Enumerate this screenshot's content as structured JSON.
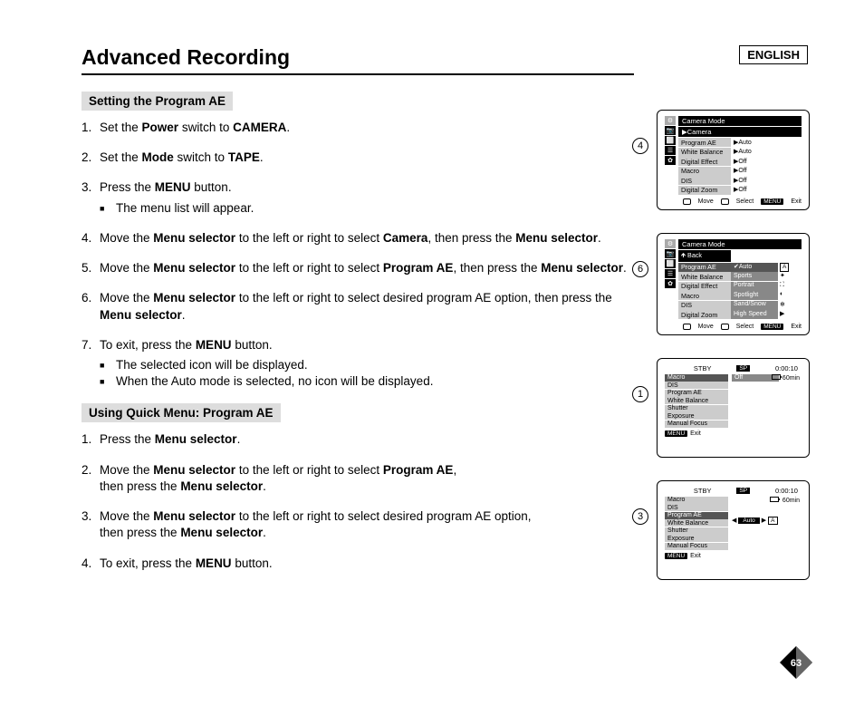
{
  "language_label": "ENGLISH",
  "page_title": "Advanced Recording",
  "page_number": "63",
  "section1": {
    "header": "Setting the Program AE",
    "steps": [
      {
        "html": "Set the <b>Power</b> switch to <b>CAMERA</b>."
      },
      {
        "html": "Set the <b>Mode</b> switch to <b>TAPE</b>."
      },
      {
        "html": "Press the <b>MENU</b> button.",
        "sub": [
          "The menu list will appear."
        ]
      },
      {
        "html": "Move the <b>Menu selector</b> to the left or right to select <b>Camera</b>, then press the <b>Menu selector</b>."
      },
      {
        "html": "Move the <b>Menu selector</b> to the left or right to select <b>Program AE</b>, then press the <b>Menu selector</b>."
      },
      {
        "html": "Move the <b>Menu selector</b> to the left or right to select desired program AE option, then press the <b>Menu selector</b>."
      },
      {
        "html": "To exit, press the <b>MENU</b> button.",
        "sub": [
          "The selected icon will be displayed.",
          "When the Auto mode is selected, no icon will be displayed."
        ]
      }
    ]
  },
  "section2": {
    "header": "Using Quick Menu: Program AE",
    "steps": [
      {
        "html": "Press the <b>Menu selector</b>."
      },
      {
        "html": "Move the <b>Menu selector</b> to the left or right to select <b>Program AE</b>,<br>then press the <b>Menu selector</b>."
      },
      {
        "html": "Move the <b>Menu selector</b> to the left or right to select desired program AE option,<br>then press the <b>Menu selector</b>."
      },
      {
        "html": "To exit, press the <b>MENU</b> button."
      }
    ]
  },
  "diagrams": {
    "footer": {
      "move": "Move",
      "select": "Select",
      "exit_chip": "MENU",
      "exit": "Exit"
    },
    "d4": {
      "num": "4",
      "header": "Camera Mode",
      "sub_header": "▶Camera",
      "rows": [
        {
          "l": "Program AE",
          "r": "▶Auto"
        },
        {
          "l": "White Balance",
          "r": "▶Auto"
        },
        {
          "l": "Digital Effect",
          "r": "▶Off"
        },
        {
          "l": "Macro",
          "r": "▶Off"
        },
        {
          "l": "DIS",
          "r": "▶Off"
        },
        {
          "l": "Digital Zoom",
          "r": "▶Off"
        }
      ]
    },
    "d6": {
      "num": "6",
      "header": "Camera Mode",
      "back": "Back",
      "left_items": [
        "Program AE",
        "White Balance",
        "Digital Effect",
        "Macro",
        "DIS",
        "Digital Zoom"
      ],
      "selected_left": 0,
      "right_items": [
        {
          "t": "✔Auto",
          "badge": "A"
        },
        {
          "t": "Sports",
          "i": "✦"
        },
        {
          "t": "Portrait",
          "i": "⛶"
        },
        {
          "t": "Spotlight",
          "i": "◐"
        },
        {
          "t": "Sand/Snow",
          "i": "❄"
        },
        {
          "t": "High Speed",
          "i": "▶"
        }
      ]
    },
    "d1": {
      "num": "1",
      "stby": "STBY",
      "sp": "SP",
      "time": "0:00:10",
      "remain": "60min",
      "items": [
        "Macro",
        "DIS",
        "Program AE",
        "White Balance",
        "Shutter",
        "Exposure",
        "Manual Focus"
      ],
      "selected": 0,
      "sel_val": "Off"
    },
    "d3": {
      "num": "3",
      "stby": "STBY",
      "sp": "SP",
      "time": "0:00:10",
      "remain": "60min",
      "items": [
        "Macro",
        "DIS",
        "Program AE",
        "White Balance",
        "Shutter",
        "Exposure",
        "Manual Focus"
      ],
      "selected": 2,
      "sel_val": "Auto",
      "sel_badge": "A"
    }
  }
}
